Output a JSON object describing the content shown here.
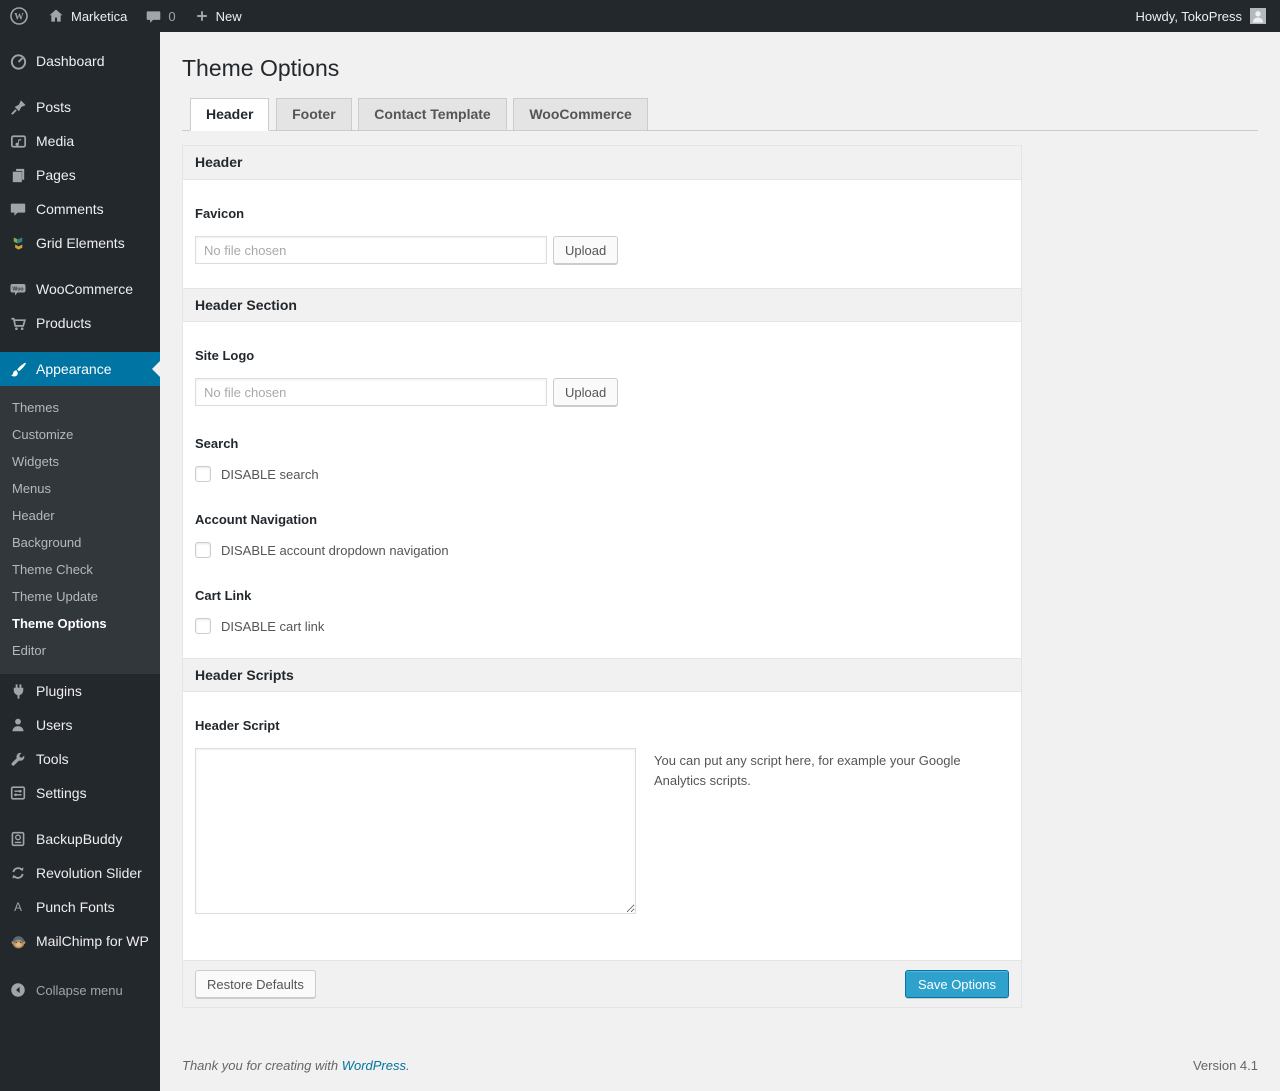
{
  "admin_bar": {
    "site_name": "Marketica",
    "comment_count": "0",
    "new_label": "New",
    "howdy": "Howdy, TokoPress",
    "icons": [
      "wordpress-logo-icon",
      "home-icon",
      "comment-icon",
      "plus-icon",
      "avatar"
    ]
  },
  "sidebar": {
    "items": [
      {
        "label": "Dashboard",
        "icon": "dashboard-icon"
      },
      {
        "label": "Posts",
        "icon": "pushpin-icon"
      },
      {
        "label": "Media",
        "icon": "media-icon"
      },
      {
        "label": "Pages",
        "icon": "pages-icon"
      },
      {
        "label": "Comments",
        "icon": "comments-icon"
      },
      {
        "label": "Grid Elements",
        "icon": "grid-elements-icon"
      },
      {
        "label": "WooCommerce",
        "icon": "woocommerce-icon"
      },
      {
        "label": "Products",
        "icon": "cart-icon"
      },
      {
        "label": "Appearance",
        "icon": "brush-icon",
        "active": true
      },
      {
        "label": "Plugins",
        "icon": "plugin-icon"
      },
      {
        "label": "Users",
        "icon": "user-icon"
      },
      {
        "label": "Tools",
        "icon": "wrench-icon"
      },
      {
        "label": "Settings",
        "icon": "settings-icon"
      },
      {
        "label": "BackupBuddy",
        "icon": "backup-icon"
      },
      {
        "label": "Revolution Slider",
        "icon": "refresh-icon"
      },
      {
        "label": "Punch Fonts",
        "icon": "letter-a-icon"
      },
      {
        "label": "MailChimp for WP",
        "icon": "mailchimp-icon"
      },
      {
        "label": "Collapse menu",
        "icon": "collapse-arrow-icon"
      }
    ],
    "appearance_submenu": [
      "Themes",
      "Customize",
      "Widgets",
      "Menus",
      "Header",
      "Background",
      "Theme Check",
      "Theme Update",
      "Theme Options",
      "Editor"
    ],
    "current_submenu_item": "Theme Options"
  },
  "main": {
    "page_title": "Theme Options",
    "tabs": [
      {
        "label": "Header",
        "active": true
      },
      {
        "label": "Footer",
        "active": false
      },
      {
        "label": "Contact Template",
        "active": false
      },
      {
        "label": "WooCommerce",
        "active": false
      }
    ],
    "panel": {
      "section1_title": "Header",
      "favicon": {
        "label": "Favicon",
        "value": "",
        "placeholder": "No file chosen",
        "upload_label": "Upload"
      },
      "section2_title": "Header Section",
      "site_logo": {
        "label": "Site Logo",
        "value": "",
        "placeholder": "No file chosen",
        "upload_label": "Upload"
      },
      "search": {
        "label": "Search",
        "checkbox_label": "DISABLE search",
        "checked": false
      },
      "account_nav": {
        "label": "Account Navigation",
        "checkbox_label": "DISABLE account dropdown navigation",
        "checked": false
      },
      "cart_link": {
        "label": "Cart Link",
        "checkbox_label": "DISABLE cart link",
        "checked": false
      },
      "section3_title": "Header Scripts",
      "header_script": {
        "label": "Header Script",
        "value": "",
        "help": "You can put any script here, for example your Google Analytics scripts."
      },
      "actions": {
        "restore_label": "Restore Defaults",
        "save_label": "Save Options"
      }
    }
  },
  "page_footer": {
    "thanks_prefix": "Thank you for creating with ",
    "thanks_link": "WordPress",
    "thanks_suffix": ".",
    "version": "Version 4.1"
  },
  "colors": {
    "adminbar_bg": "#23282d",
    "sidebar_bg": "#23282d",
    "submenu_bg": "#32373c",
    "accent": "#0074a2",
    "primary_button": "#2ea2cc",
    "page_bg": "#f1f1f1",
    "panel_border": "#e5e5e5"
  }
}
